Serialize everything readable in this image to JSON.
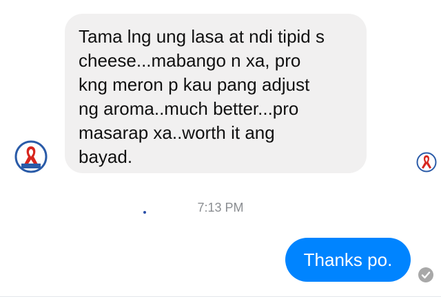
{
  "conversation": {
    "incoming_message": "Tama lng ung lasa at ndi tipid s\ncheese...mabango n xa, pro\nkng meron p kau pang adjust\nng aroma..much better...pro\nmasarap xa..worth it ang\nbayad.",
    "timestamp": "7:13 PM",
    "outgoing_message": "Thanks po."
  },
  "icons": {
    "sender_avatar": "red-ribbon-logo-icon",
    "read_receipt_avatar": "red-ribbon-logo-icon",
    "seen_indicator": "check-circle-icon"
  },
  "colors": {
    "incoming_bubble": "#f1f0f0",
    "outgoing_bubble": "#0084ff",
    "timestamp_text": "#8a8d91",
    "seen_indicator": "#a8a8a8"
  }
}
